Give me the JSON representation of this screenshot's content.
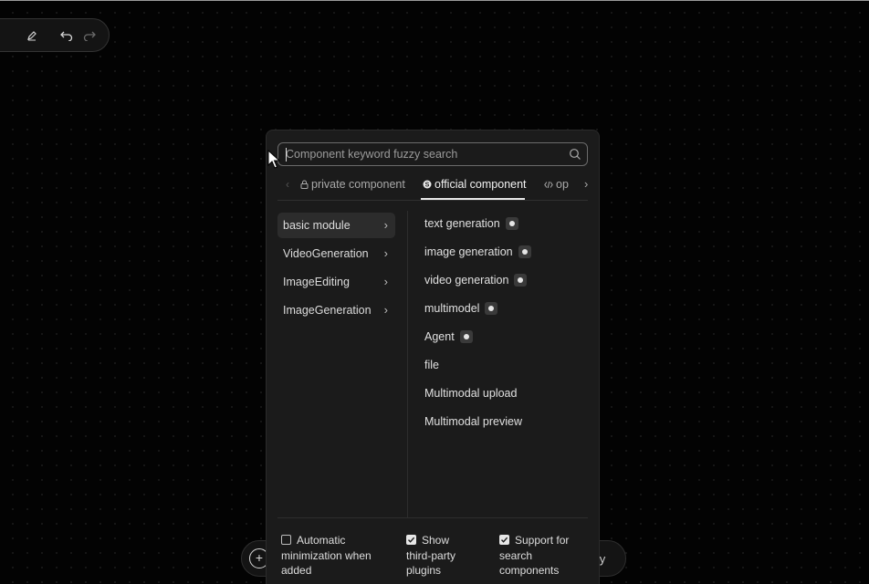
{
  "search": {
    "placeholder": "Component keyword fuzzy search"
  },
  "tabs": [
    {
      "label": "private component",
      "icon": "lock-icon",
      "active": false
    },
    {
      "label": "official component",
      "icon": "official-badge-icon",
      "active": true
    },
    {
      "label": "op",
      "icon": "code-icon",
      "active": false
    }
  ],
  "categories": [
    {
      "label": "basic module",
      "active": true
    },
    {
      "label": "VideoGeneration",
      "active": false
    },
    {
      "label": "ImageEditing",
      "active": false
    },
    {
      "label": "ImageGeneration",
      "active": false
    }
  ],
  "components": [
    {
      "label": "text generation",
      "has_badge": true
    },
    {
      "label": "image generation",
      "has_badge": true
    },
    {
      "label": "video generation",
      "has_badge": true
    },
    {
      "label": "multimodel",
      "has_badge": true
    },
    {
      "label": "Agent",
      "has_badge": true
    },
    {
      "label": "file",
      "has_badge": false
    },
    {
      "label": "Multimodal upload",
      "has_badge": false
    },
    {
      "label": "Multimodal preview",
      "has_badge": false
    }
  ],
  "options": {
    "auto_minimize": {
      "line1": "Automatic",
      "line2": "minimization when",
      "line3": "added",
      "checked": false
    },
    "third_party": {
      "line1": "Show",
      "line2": "third-party",
      "line3": "plugins",
      "checked": true
    },
    "search_components": {
      "line1": "Support for",
      "line2": "search",
      "line3": "components",
      "checked": true
    }
  },
  "bottom_bar": {
    "add_symbol": "+",
    "trailing_text": "lly"
  }
}
